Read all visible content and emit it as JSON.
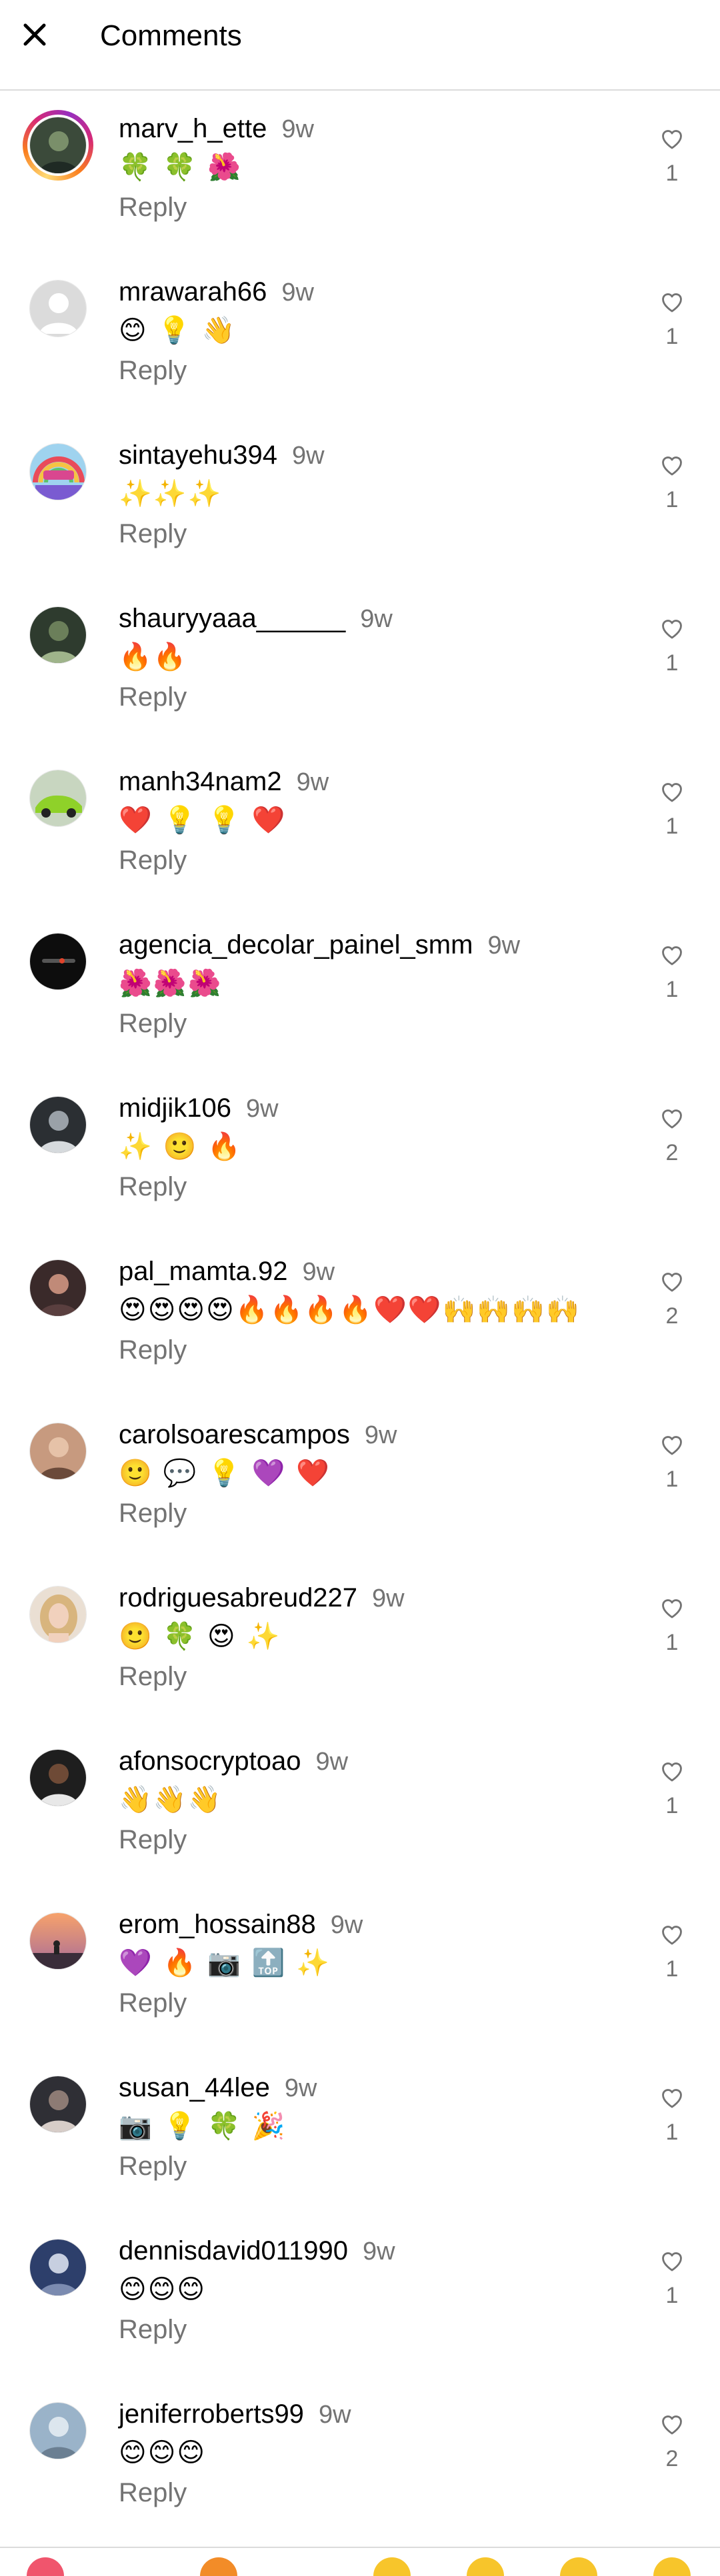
{
  "header": {
    "title": "Comments",
    "close_icon": "close-icon"
  },
  "reply_label": "Reply",
  "comments": [
    {
      "username": "marv_h_ette",
      "time": "9w",
      "text": "🍀 🍀 🌺",
      "likes": "1",
      "story": true,
      "avatar": "photo"
    },
    {
      "username": "mrawarah66",
      "time": "9w",
      "text": "😊 💡 👋",
      "likes": "1",
      "avatar": "default"
    },
    {
      "username": "sintayehu394",
      "time": "9w",
      "text": "✨✨✨",
      "likes": "1",
      "avatar": "rainbow"
    },
    {
      "username": "shauryyaaa______",
      "time": "9w",
      "text": "🔥🔥",
      "likes": "1",
      "avatar": "photo"
    },
    {
      "username": "manh34nam2",
      "time": "9w",
      "text": "❤️ 💡 💡 ❤️",
      "likes": "1",
      "avatar": "car"
    },
    {
      "username": "agencia_decolar_painel_smm",
      "time": "9w",
      "text": "🌺🌺🌺",
      "likes": "1",
      "avatar": "dark"
    },
    {
      "username": "midjik106",
      "time": "9w",
      "text": "✨ 🙂 🔥",
      "likes": "2",
      "avatar": "photo"
    },
    {
      "username": "pal_mamta.92",
      "time": "9w",
      "text": "😍😍😍😍🔥🔥🔥🔥❤️❤️🙌🙌🙌🙌",
      "likes": "2",
      "avatar": "photo"
    },
    {
      "username": "carolsoarescampos",
      "time": "9w",
      "text": "🙂 💬 💡 💜 ❤️",
      "likes": "1",
      "avatar": "photo"
    },
    {
      "username": "rodriguesabreud227",
      "time": "9w",
      "text": "🙂 🍀 😍 ✨",
      "likes": "1",
      "avatar": "blond"
    },
    {
      "username": "afonsocryptoao",
      "time": "9w",
      "text": "👋👋👋",
      "likes": "1",
      "avatar": "photo"
    },
    {
      "username": "erom_hossain88",
      "time": "9w",
      "text": "💜 🔥 📷 🔝 ✨",
      "likes": "1",
      "avatar": "sunset"
    },
    {
      "username": "susan_44lee",
      "time": "9w",
      "text": "📷 💡 🍀 🎉",
      "likes": "1",
      "avatar": "photo"
    },
    {
      "username": "dennisdavid011990",
      "time": "9w",
      "text": "😊😊😊",
      "likes": "1",
      "avatar": "photo"
    },
    {
      "username": "jeniferroberts99",
      "time": "9w",
      "text": "😊😊😊",
      "likes": "2",
      "avatar": "photo"
    }
  ],
  "colors": {
    "secondary_text": "#737373",
    "divider": "#dbdbdb",
    "story_ring": "#d62976"
  }
}
